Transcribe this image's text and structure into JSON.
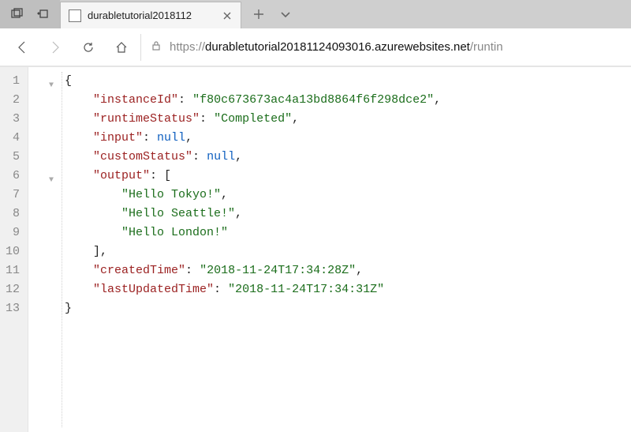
{
  "tabbar": {
    "tablist_icon": "tab-groups-icon",
    "set_aside_icon": "set-aside-icon",
    "active_tab_title": "durabletutorial2018112",
    "close_label": "×",
    "newtab_label": "+",
    "more_label": "⌄"
  },
  "nav": {
    "back": "←",
    "forward": "→",
    "refresh": "⟳",
    "home": "⌂"
  },
  "address": {
    "protocol": "https://",
    "host": "durabletutorial20181124093016.azurewebsites.net",
    "path": "/runtin"
  },
  "json": {
    "lines": {
      "l1": "{",
      "l2_key": "\"instanceId\"",
      "l2_val": "\"f80c673673ac4a13bd8864f6f298dce2\"",
      "l3_key": "\"runtimeStatus\"",
      "l3_val": "\"Completed\"",
      "l4_key": "\"input\"",
      "l4_val": "null",
      "l5_key": "\"customStatus\"",
      "l5_val": "null",
      "l6_key": "\"output\"",
      "l6_val": "[",
      "l7_val": "\"Hello Tokyo!\"",
      "l8_val": "\"Hello Seattle!\"",
      "l9_val": "\"Hello London!\"",
      "l10": "]",
      "l11_key": "\"createdTime\"",
      "l11_val": "\"2018-11-24T17:34:28Z\"",
      "l12_key": "\"lastUpdatedTime\"",
      "l12_val": "\"2018-11-24T17:34:31Z\"",
      "l13": "}"
    },
    "line_numbers": [
      "1",
      "2",
      "3",
      "4",
      "5",
      "6",
      "7",
      "8",
      "9",
      "10",
      "11",
      "12",
      "13"
    ]
  }
}
